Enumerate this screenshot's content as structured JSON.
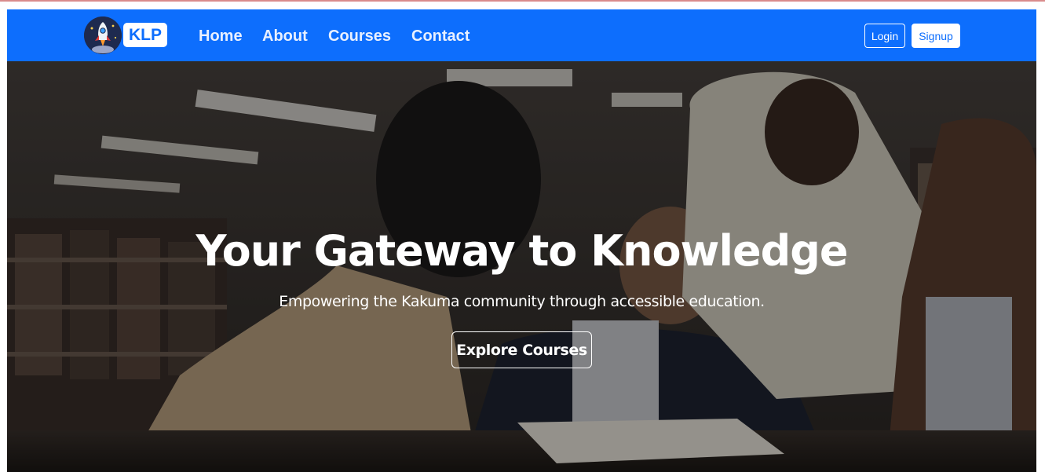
{
  "brand": {
    "logo_icon": "rocket-icon",
    "name": "KLP"
  },
  "nav": {
    "links": [
      {
        "label": "Home"
      },
      {
        "label": "About"
      },
      {
        "label": "Courses"
      },
      {
        "label": "Contact"
      }
    ],
    "login_label": "Login",
    "signup_label": "Signup"
  },
  "hero": {
    "title": "Your Gateway to Knowledge",
    "subtitle": "Empowering the Kakuma community through accessible education.",
    "cta_label": "Explore Courses"
  },
  "colors": {
    "primary": "#0d6efd",
    "white": "#ffffff"
  }
}
